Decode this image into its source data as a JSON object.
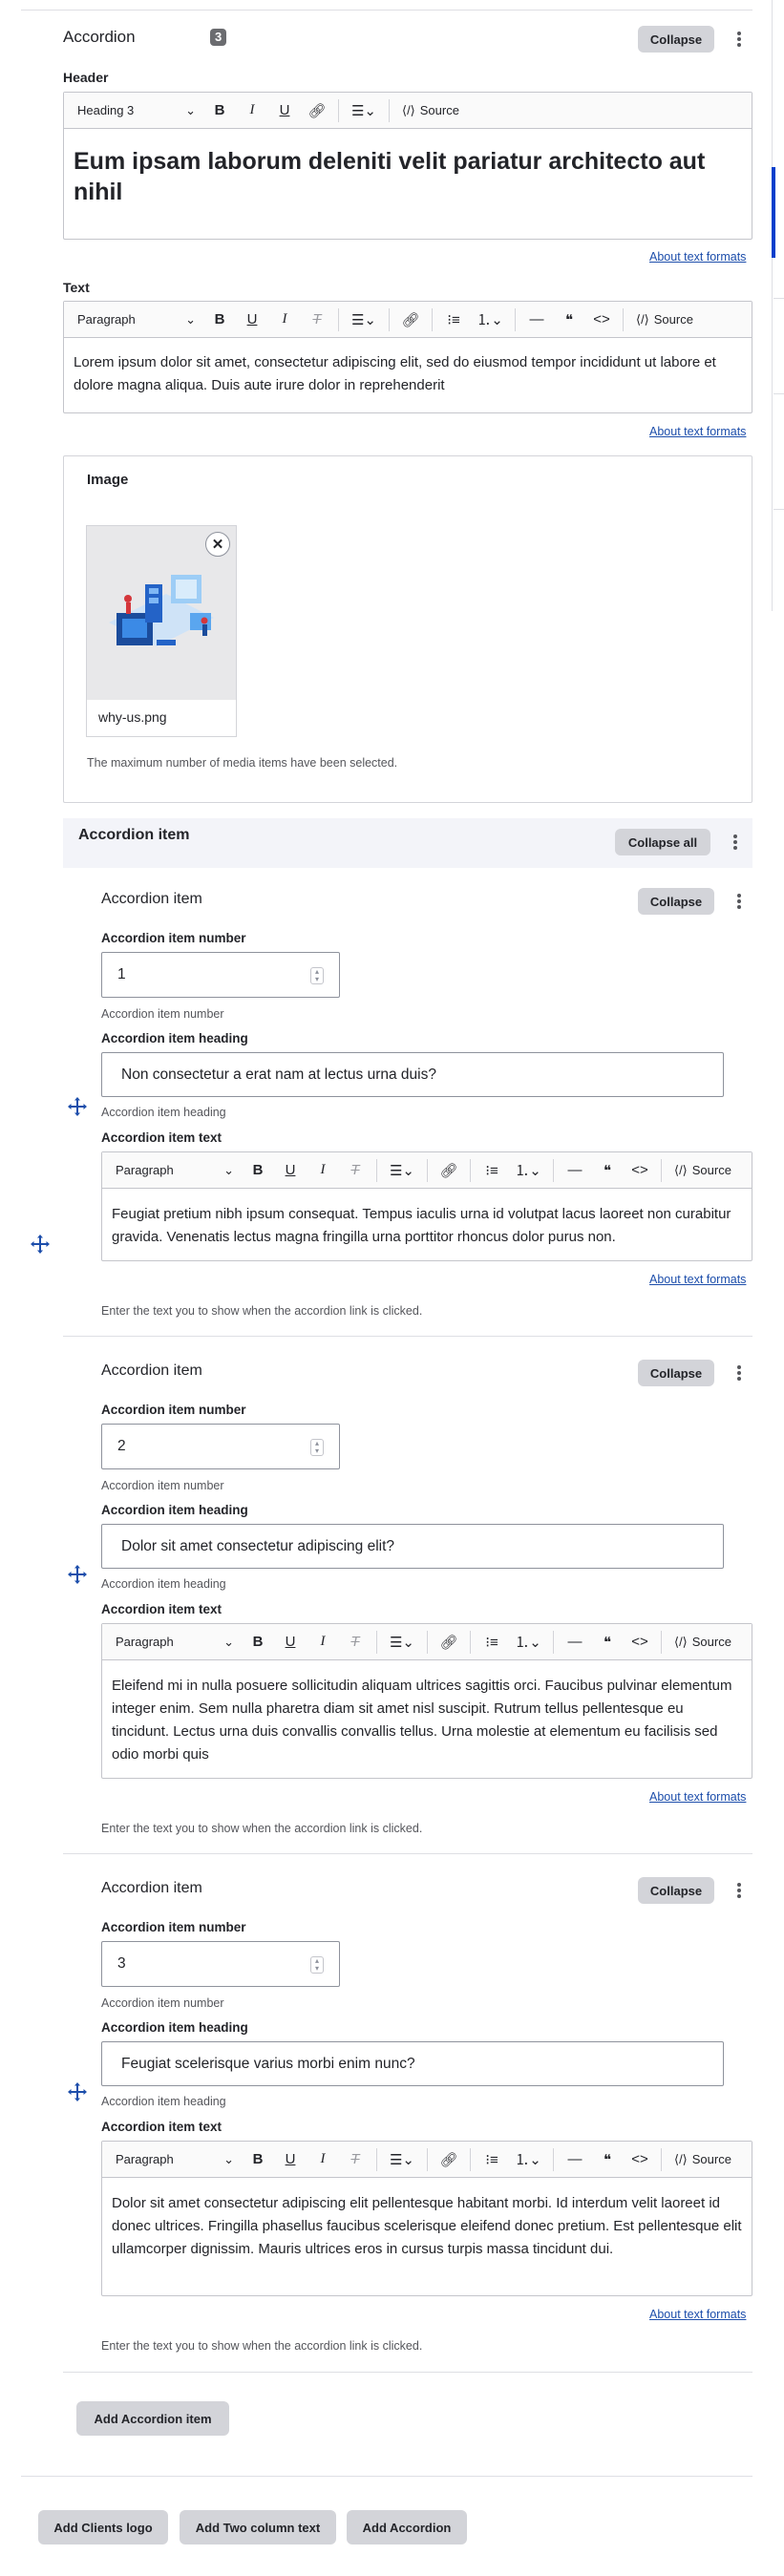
{
  "accordion": {
    "title": "Accordion",
    "count": "3",
    "collapse": "Collapse",
    "header_label": "Header",
    "header_format": "Heading 3",
    "header_text_normal": "Eum ipsam laborum deleniti ",
    "header_text_bold": "velit pariatur architecto aut nihil",
    "about_formats": "About text formats",
    "text_label": "Text",
    "text_format": "Paragraph",
    "text_content": "Lorem ipsum dolor sit amet, consectetur adipiscing elit, sed do eiusmod tempor incididunt ut labore et dolore magna aliqua. Duis aute irure dolor in reprehenderit",
    "source": "Source",
    "image_label": "Image",
    "image_filename": "why-us.png",
    "image_note": "The maximum number of media items have been selected."
  },
  "items_section": {
    "title": "Accordion item",
    "collapse_all": "Collapse all"
  },
  "items": [
    {
      "title": "Accordion item",
      "collapse": "Collapse",
      "number_label": "Accordion item number",
      "number_value": "1",
      "number_help": "Accordion item number",
      "heading_label": "Accordion item heading",
      "heading_value": "Non consectetur a erat nam at lectus urna duis?",
      "heading_help": "Accordion item heading",
      "text_label": "Accordion item text",
      "format": "Paragraph",
      "source": "Source",
      "text": "Feugiat pretium nibh ipsum consequat. Tempus iaculis urna id volutpat lacus laoreet non curabitur gravida. Venenatis lectus magna fringilla urna porttitor rhoncus dolor purus non.",
      "about": "About text formats",
      "help": "Enter the text you to show when the accordion link is clicked."
    },
    {
      "title": "Accordion item",
      "collapse": "Collapse",
      "number_label": "Accordion item number",
      "number_value": "2",
      "number_help": "Accordion item number",
      "heading_label": "Accordion item heading",
      "heading_value": "Dolor sit amet consectetur adipiscing elit?",
      "heading_help": "Accordion item heading",
      "text_label": "Accordion item text",
      "format": "Paragraph",
      "source": "Source",
      "text": "Eleifend mi in nulla posuere sollicitudin aliquam ultrices sagittis orci. Faucibus pulvinar elementum integer enim. Sem nulla pharetra diam sit amet nisl suscipit. Rutrum tellus pellentesque eu tincidunt. Lectus urna duis convallis convallis tellus. Urna molestie at elementum eu facilisis sed odio morbi quis",
      "about": "About text formats",
      "help": "Enter the text you to show when the accordion link is clicked."
    },
    {
      "title": "Accordion item",
      "collapse": "Collapse",
      "number_label": "Accordion item number",
      "number_value": "3",
      "number_help": "Accordion item number",
      "heading_label": "Accordion item heading",
      "heading_value": "Feugiat scelerisque varius morbi enim nunc?",
      "heading_help": "Accordion item heading",
      "text_label": "Accordion item text",
      "format": "Paragraph",
      "source": "Source",
      "text": "Dolor sit amet consectetur adipiscing elit pellentesque habitant morbi. Id interdum velit laoreet id donec ultrices. Fringilla phasellus faucibus scelerisque eleifend donec pretium. Est pellentesque elit ullamcorper dignissim. Mauris ultrices eros in cursus turpis massa tincidunt dui.",
      "about": "About text formats",
      "help": "Enter the text you to show when the accordion link is clicked."
    }
  ],
  "add_item_button": "Add Accordion item",
  "bottom_buttons": [
    "Add Clients logo",
    "Add Two column text",
    "Add Accordion"
  ],
  "colors": {
    "accent": "#003ecc",
    "button_bg": "#d3d4d9",
    "link": "#1d4eab"
  }
}
